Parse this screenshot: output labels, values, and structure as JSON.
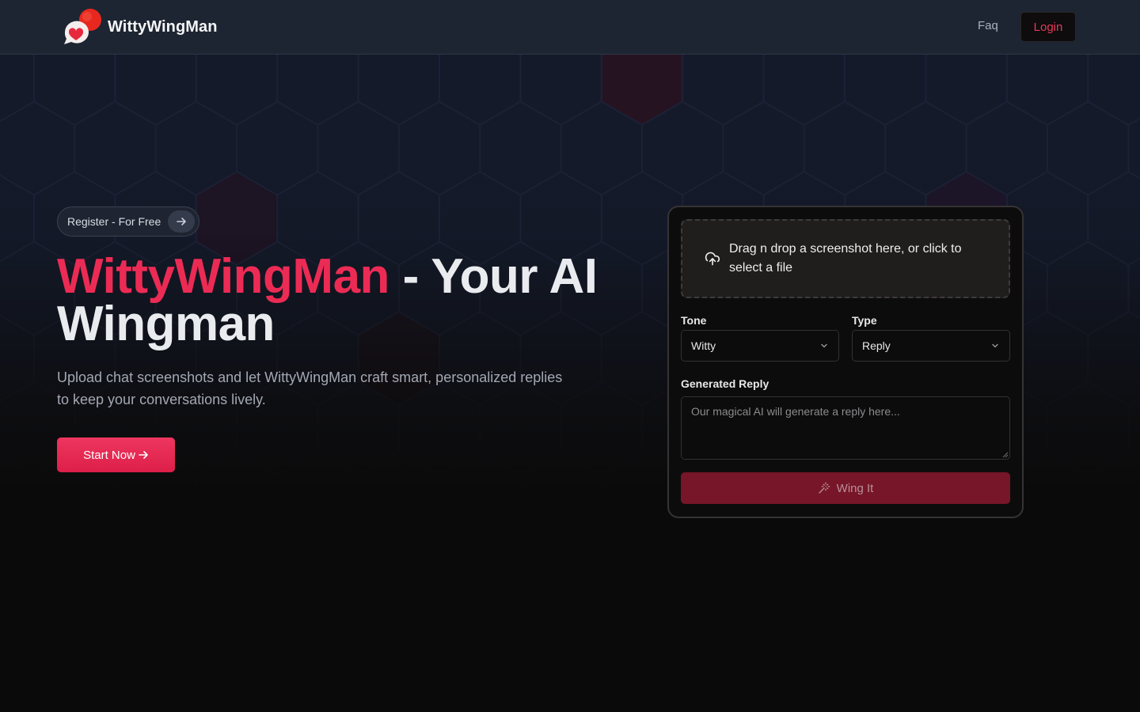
{
  "colors": {
    "accent": "#ec2b55",
    "header_bg": "#1d2532",
    "page_bg": "#0b0a0a",
    "card_bg": "#0d0c0c",
    "wing_button_bg": "#761628"
  },
  "header": {
    "brand_name": "WittyWingMan",
    "logo_icon": "chat-bubbles-heart-icon",
    "nav": {
      "faq": "Faq",
      "login": "Login"
    }
  },
  "hero": {
    "register_pill": "Register - For Free",
    "title_accent": "WittyWingMan",
    "title_rest": " - Your AI Wingman",
    "subtitle": "Upload chat screenshots and let WittyWingMan craft smart, personalized replies to keep your conversations lively.",
    "start_button": "Start Now"
  },
  "card": {
    "dropzone_text": "Drag n drop a screenshot here, or click to select a file",
    "dropzone_icon": "cloud-upload-icon",
    "tone": {
      "label": "Tone",
      "value": "Witty"
    },
    "type": {
      "label": "Type",
      "value": "Reply"
    },
    "generated_reply": {
      "label": "Generated Reply",
      "placeholder": "Our magical AI will generate a reply here..."
    },
    "wing_button": "Wing It",
    "wing_icon": "magic-wand-icon"
  }
}
